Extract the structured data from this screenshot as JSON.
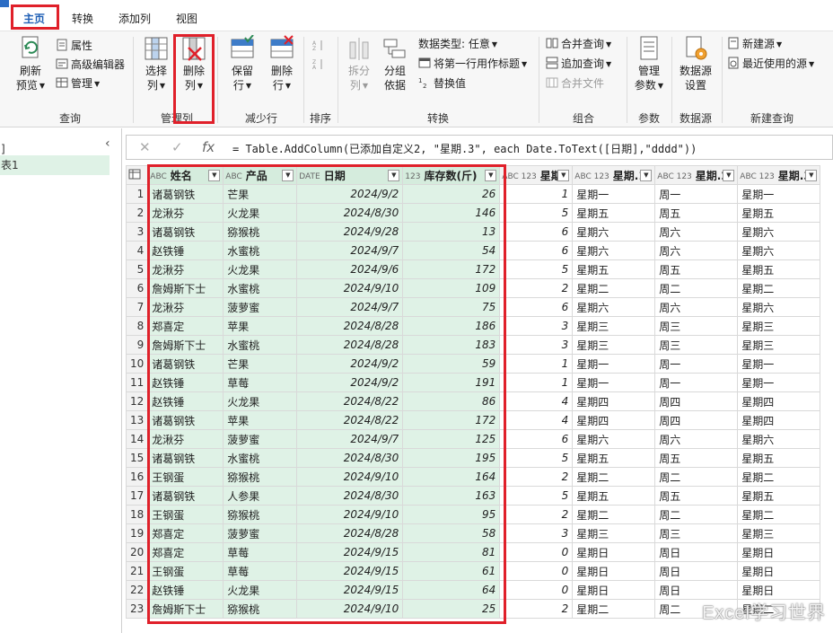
{
  "menu": {
    "tabs": [
      {
        "label": "主页",
        "active": true
      },
      {
        "label": "转换",
        "active": false
      },
      {
        "label": "添加列",
        "active": false
      },
      {
        "label": "视图",
        "active": false
      }
    ]
  },
  "ribbon": {
    "groups": {
      "query": "查询",
      "manage_columns": "管理列",
      "reduce_rows": "减少行",
      "sort": "排序",
      "transform": "转换",
      "combine": "组合",
      "params": "参数",
      "datasource": "数据源",
      "new_query": "新建查询"
    },
    "refresh": [
      "刷新",
      "预览"
    ],
    "properties": "属性",
    "advanced_editor": "高级编辑器",
    "manage": "管理",
    "choose_columns": [
      "选择",
      "列"
    ],
    "remove_columns": [
      "删除",
      "列"
    ],
    "keep_rows": [
      "保留",
      "行"
    ],
    "remove_rows": [
      "删除",
      "行"
    ],
    "split_column": [
      "拆分",
      "列"
    ],
    "group_by": [
      "分组",
      "依据"
    ],
    "data_type": "数据类型: 任意",
    "first_row_header": "将第一行用作标题",
    "replace_values": "替换值",
    "merge_queries": "合并查询",
    "append_queries": "追加查询",
    "combine_files": "合并文件",
    "manage_params": [
      "管理",
      "参数"
    ],
    "datasource_settings": [
      "数据源",
      "设置"
    ],
    "new_source": "新建源",
    "recent_sources": "最近使用的源"
  },
  "left": {
    "items": [
      "]",
      "表1"
    ]
  },
  "formula": {
    "cancel": "✕",
    "confirm": "✓",
    "fx": "fx",
    "text": "= Table.AddColumn(已添加自定义2, \"星期.3\", each Date.ToText([日期],\"dddd\"))"
  },
  "grid": {
    "columns": [
      {
        "type": "ABC",
        "name": "姓名"
      },
      {
        "type": "ABC",
        "name": "产品"
      },
      {
        "type": "DATE",
        "name": "日期"
      },
      {
        "type": "123",
        "name": "库存数(斤)"
      },
      {
        "type": "ABC 123",
        "name": "星期"
      },
      {
        "type": "ABC 123",
        "name": "星期.1"
      },
      {
        "type": "ABC 123",
        "name": "星期.2"
      },
      {
        "type": "ABC 123",
        "name": "星期.3"
      }
    ],
    "rows": [
      [
        "1",
        "诸葛钢铁",
        "芒果",
        "2024/9/2",
        "26",
        "1",
        "星期一",
        "周一",
        "星期一"
      ],
      [
        "2",
        "龙湫芬",
        "火龙果",
        "2024/8/30",
        "146",
        "5",
        "星期五",
        "周五",
        "星期五"
      ],
      [
        "3",
        "诸葛钢铁",
        "猕猴桃",
        "2024/9/28",
        "13",
        "6",
        "星期六",
        "周六",
        "星期六"
      ],
      [
        "4",
        "赵铁锤",
        "水蜜桃",
        "2024/9/7",
        "54",
        "6",
        "星期六",
        "周六",
        "星期六"
      ],
      [
        "5",
        "龙湫芬",
        "火龙果",
        "2024/9/6",
        "172",
        "5",
        "星期五",
        "周五",
        "星期五"
      ],
      [
        "6",
        "詹姆斯下士",
        "水蜜桃",
        "2024/9/10",
        "109",
        "2",
        "星期二",
        "周二",
        "星期二"
      ],
      [
        "7",
        "龙湫芬",
        "菠萝蜜",
        "2024/9/7",
        "75",
        "6",
        "星期六",
        "周六",
        "星期六"
      ],
      [
        "8",
        "郑喜定",
        "苹果",
        "2024/8/28",
        "186",
        "3",
        "星期三",
        "周三",
        "星期三"
      ],
      [
        "9",
        "詹姆斯下士",
        "水蜜桃",
        "2024/8/28",
        "183",
        "3",
        "星期三",
        "周三",
        "星期三"
      ],
      [
        "10",
        "诸葛钢铁",
        "芒果",
        "2024/9/2",
        "59",
        "1",
        "星期一",
        "周一",
        "星期一"
      ],
      [
        "11",
        "赵铁锤",
        "草莓",
        "2024/9/2",
        "191",
        "1",
        "星期一",
        "周一",
        "星期一"
      ],
      [
        "12",
        "赵铁锤",
        "火龙果",
        "2024/8/22",
        "86",
        "4",
        "星期四",
        "周四",
        "星期四"
      ],
      [
        "13",
        "诸葛钢铁",
        "苹果",
        "2024/8/22",
        "172",
        "4",
        "星期四",
        "周四",
        "星期四"
      ],
      [
        "14",
        "龙湫芬",
        "菠萝蜜",
        "2024/9/7",
        "125",
        "6",
        "星期六",
        "周六",
        "星期六"
      ],
      [
        "15",
        "诸葛钢铁",
        "水蜜桃",
        "2024/8/30",
        "195",
        "5",
        "星期五",
        "周五",
        "星期五"
      ],
      [
        "16",
        "王钢蛋",
        "猕猴桃",
        "2024/9/10",
        "164",
        "2",
        "星期二",
        "周二",
        "星期二"
      ],
      [
        "17",
        "诸葛钢铁",
        "人参果",
        "2024/8/30",
        "163",
        "5",
        "星期五",
        "周五",
        "星期五"
      ],
      [
        "18",
        "王钢蛋",
        "猕猴桃",
        "2024/9/10",
        "95",
        "2",
        "星期二",
        "周二",
        "星期二"
      ],
      [
        "19",
        "郑喜定",
        "菠萝蜜",
        "2024/8/28",
        "58",
        "3",
        "星期三",
        "周三",
        "星期三"
      ],
      [
        "20",
        "郑喜定",
        "草莓",
        "2024/9/15",
        "81",
        "0",
        "星期日",
        "周日",
        "星期日"
      ],
      [
        "21",
        "王钢蛋",
        "草莓",
        "2024/9/15",
        "61",
        "0",
        "星期日",
        "周日",
        "星期日"
      ],
      [
        "22",
        "赵铁锤",
        "火龙果",
        "2024/9/15",
        "64",
        "0",
        "星期日",
        "周日",
        "星期日"
      ],
      [
        "23",
        "詹姆斯下士",
        "猕猴桃",
        "2024/9/10",
        "25",
        "2",
        "星期二",
        "周二",
        "星期二"
      ]
    ]
  },
  "watermark": "Excel学习世界",
  "colors": {
    "highlight": "#dff2e6",
    "annotation_red": "#e0202a",
    "active_tab": "#1f5fb5"
  }
}
